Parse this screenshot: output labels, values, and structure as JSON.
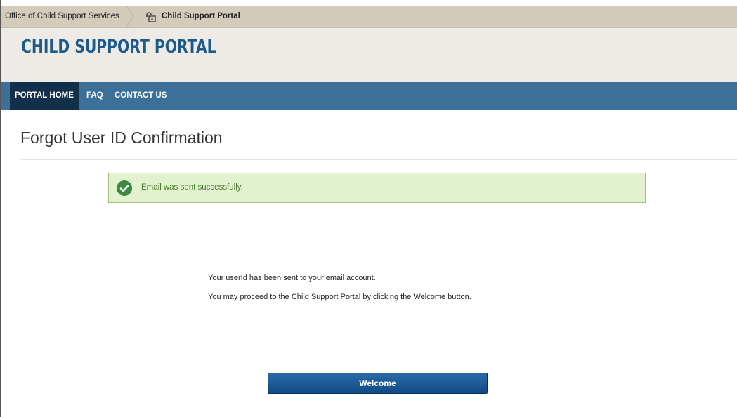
{
  "breadcrumb": {
    "first": "Office of Child Support Services",
    "second": "Child Support Portal"
  },
  "header": {
    "title": "CHILD SUPPORT PORTAL"
  },
  "nav": {
    "items": [
      {
        "label": "PORTAL HOME"
      },
      {
        "label": "FAQ"
      },
      {
        "label": "CONTACT US"
      }
    ]
  },
  "page": {
    "title": "Forgot User ID Confirmation",
    "alert": "Email was sent successfully.",
    "message_1": "Your userId has been sent to your email account.",
    "message_2": "You may proceed to the Child Support Portal by clicking the Welcome button.",
    "button_label": "Welcome"
  },
  "colors": {
    "nav": "#3c7099",
    "nav_active": "#13304a",
    "title": "#1c5a8c",
    "alert_bg": "#e2f2cf",
    "success": "#3c8a3c",
    "button": "#1a5894"
  },
  "icons": {
    "breadcrumb": "lock-icon",
    "alert": "check-circle-icon"
  }
}
